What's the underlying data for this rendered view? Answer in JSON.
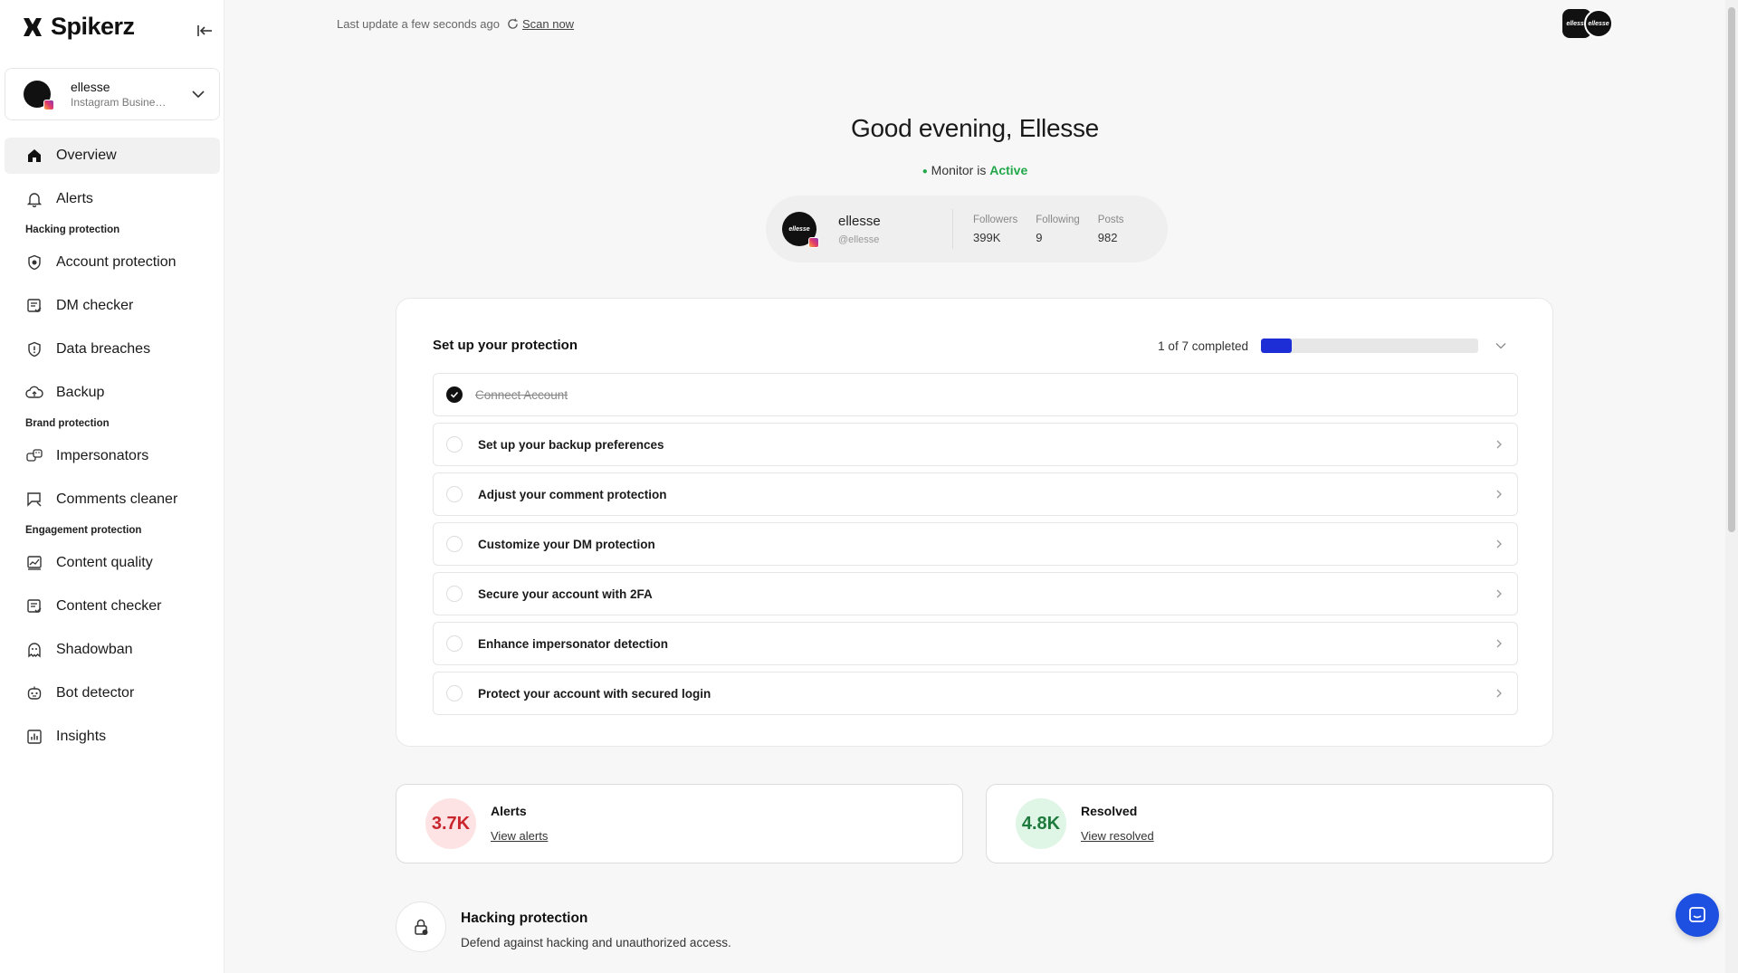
{
  "brand": {
    "name": "Spikerz"
  },
  "account": {
    "name": "ellesse",
    "type": "Instagram Business Account"
  },
  "nav": {
    "overview": "Overview",
    "alerts": "Alerts",
    "section_hacking": "Hacking protection",
    "account_protection": "Account protection",
    "dm_checker": "DM checker",
    "data_breaches": "Data breaches",
    "backup": "Backup",
    "section_brand": "Brand protection",
    "impersonators": "Impersonators",
    "comments_cleaner": "Comments cleaner",
    "section_engagement": "Engagement protection",
    "content_quality": "Content quality",
    "content_checker": "Content checker",
    "shadowban": "Shadowban",
    "bot_detector": "Bot detector",
    "insights": "Insights"
  },
  "topbar": {
    "last_update": "Last update a few seconds ago",
    "scan_now": "Scan now",
    "avatar_label": "ellesse"
  },
  "greeting": "Good evening, Ellesse",
  "monitor": {
    "prefix": "Monitor is",
    "status": "Active"
  },
  "profile": {
    "name": "ellesse",
    "handle": "@ellesse",
    "avatar_label": "ellesse",
    "followers_label": "Followers",
    "followers": "399K",
    "following_label": "Following",
    "following": "9",
    "posts_label": "Posts",
    "posts": "982"
  },
  "setup": {
    "title": "Set up your protection",
    "progress_text": "1 of 7 completed",
    "progress_fraction": 0.1428,
    "steps": [
      {
        "label": "Connect Account",
        "done": true
      },
      {
        "label": "Set up your backup preferences",
        "done": false
      },
      {
        "label": "Adjust your comment protection",
        "done": false
      },
      {
        "label": "Customize your DM protection",
        "done": false
      },
      {
        "label": "Secure your account with 2FA",
        "done": false
      },
      {
        "label": "Enhance impersonator detection",
        "done": false
      },
      {
        "label": "Protect your account with secured login",
        "done": false
      }
    ]
  },
  "stats": {
    "alerts": {
      "value": "3.7K",
      "title": "Alerts",
      "link": "View alerts"
    },
    "resolved": {
      "value": "4.8K",
      "title": "Resolved",
      "link": "View resolved"
    }
  },
  "hacking_section": {
    "title": "Hacking protection",
    "description": "Defend against hacking and unauthorized access."
  },
  "colors": {
    "accent": "#1d2ed6",
    "active_green": "#22a84a",
    "alert_red": "#c9252c",
    "resolved_green": "#1f7a3e",
    "chat_blue": "#1d4fe0"
  }
}
